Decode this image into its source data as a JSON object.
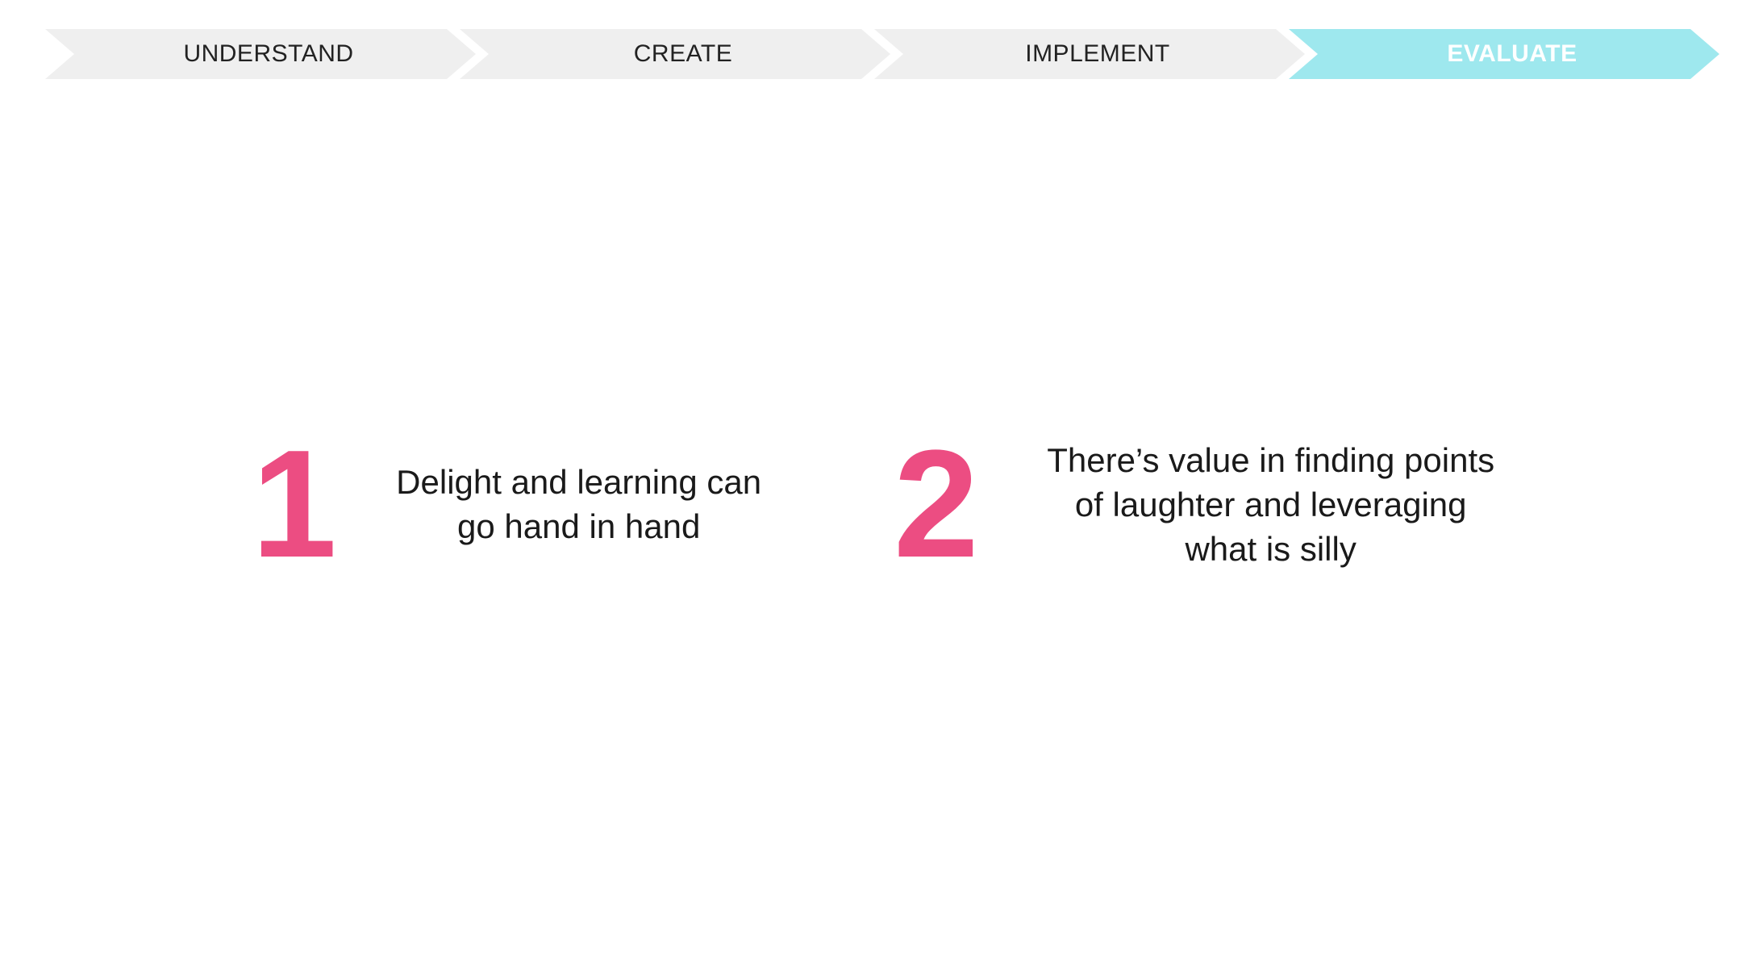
{
  "process_steps": [
    {
      "label": "UNDERSTAND",
      "active": false
    },
    {
      "label": "CREATE",
      "active": false
    },
    {
      "label": "IMPLEMENT",
      "active": false
    },
    {
      "label": "EVALUATE",
      "active": true
    }
  ],
  "points": [
    {
      "number": "1",
      "lines": [
        "Delight and learning can",
        "go hand in hand"
      ]
    },
    {
      "number": "2",
      "lines": [
        "There’s value in finding points",
        "of laughter and leveraging",
        "what is silly"
      ]
    }
  ],
  "colors": {
    "accent_number": "#ec4d82",
    "active_step": "#9ee8ee",
    "inactive_step": "#efefef"
  }
}
